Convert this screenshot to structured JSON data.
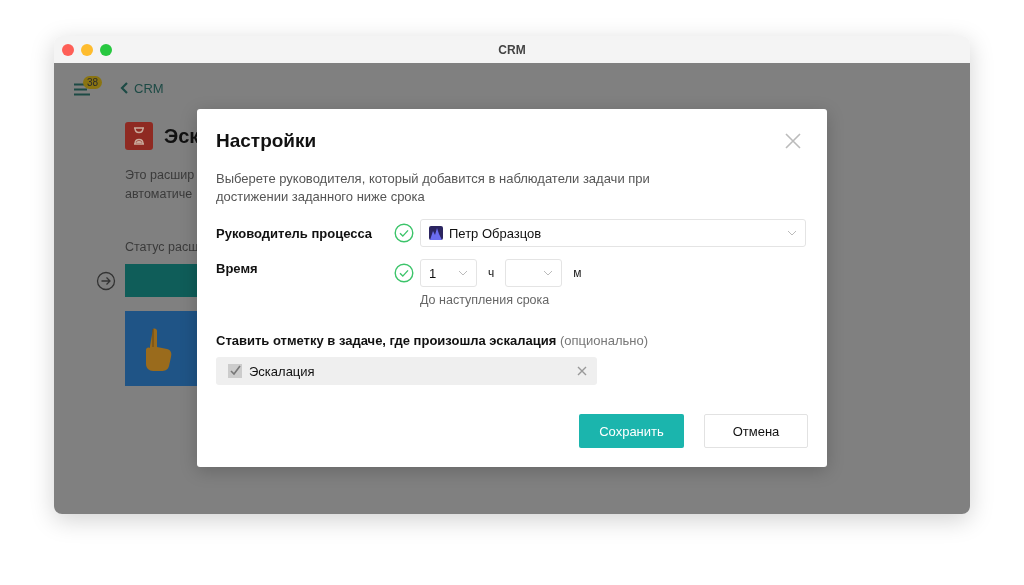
{
  "window": {
    "title": "CRM"
  },
  "background": {
    "menu_badge": "38",
    "back_link": "CRM",
    "header_title": "Эск",
    "description_lines": [
      "Это расшир",
      "автоматиче"
    ],
    "status_label": "Статус расш"
  },
  "modal": {
    "title": "Настройки",
    "description": "Выберете руководителя, который добавится в наблюдатели задачи при достижении заданного ниже срока",
    "manager": {
      "label": "Руководитель процесса",
      "valid": true,
      "value": "Петр Образцов"
    },
    "time": {
      "label": "Время",
      "valid": true,
      "hours": "1",
      "hours_unit": "ч",
      "minutes_unit": "м",
      "hint": "До наступления срока"
    },
    "mark": {
      "label": "**Ставить отметку в задаче, где произошла эскалация** (опционально)",
      "tag": {
        "label": "Эскалация",
        "checked": true
      }
    },
    "buttons": [
      {
        "label": "Сохранить",
        "kind": "primary"
      },
      {
        "label": "Отмена",
        "kind": "secondary"
      }
    ]
  }
}
